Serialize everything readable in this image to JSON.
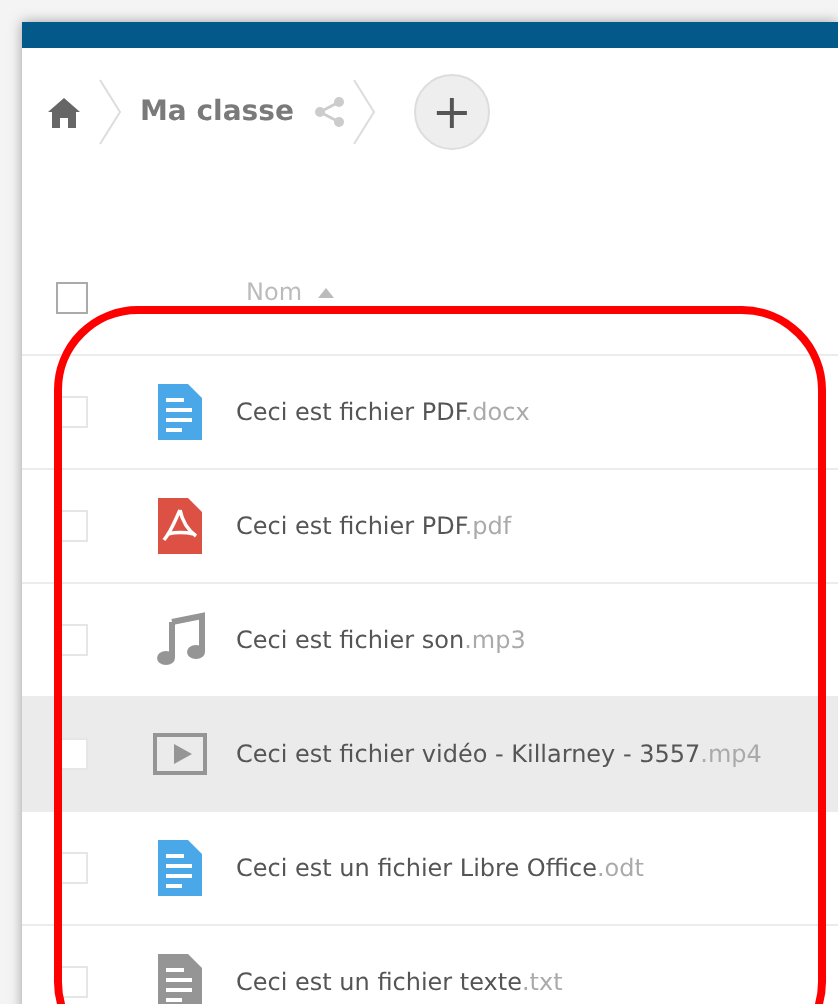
{
  "breadcrumb": {
    "folder": "Ma classe",
    "add_button": "+"
  },
  "table": {
    "column": "Nom",
    "select_all": false,
    "rows": [
      {
        "kind": "document",
        "color": "#4aa8e8",
        "name": "Ceci est fichier PDF",
        "extension": ".docx",
        "highlighted": false,
        "checked": false
      },
      {
        "kind": "pdf",
        "color": "#dd5144",
        "name": "Ceci est fichier PDF",
        "extension": ".pdf",
        "highlighted": false,
        "checked": false
      },
      {
        "kind": "audio",
        "color": "#959595",
        "name": "Ceci est fichier son",
        "extension": ".mp3",
        "highlighted": false,
        "checked": false
      },
      {
        "kind": "video",
        "color": "#959595",
        "name": "Ceci est fichier vidéo - Killarney - 3557",
        "extension": ".mp4",
        "highlighted": true,
        "checked": false
      },
      {
        "kind": "document",
        "color": "#4aa8e8",
        "name": "Ceci est un fichier Libre Office",
        "extension": ".odt",
        "highlighted": false,
        "checked": false
      },
      {
        "kind": "document",
        "color": "#959595",
        "name": "Ceci est un fichier texte",
        "extension": ".txt",
        "highlighted": false,
        "checked": false
      }
    ]
  },
  "annotation": {
    "kind": "outline",
    "color": "#ff0000"
  }
}
